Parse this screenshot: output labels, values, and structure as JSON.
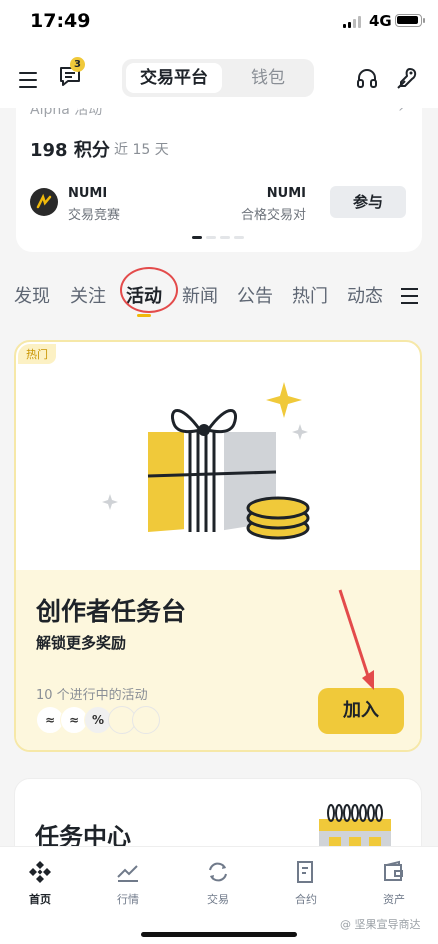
{
  "status_bar": {
    "time": "17:49",
    "network": "4G"
  },
  "top_nav": {
    "message_badge": "3",
    "segments": [
      "交易平台",
      "钱包"
    ]
  },
  "alpha_card": {
    "title": "Alpha 活动",
    "points": "198 积分",
    "points_period": "近 15 天",
    "left_token": "NUMI",
    "left_sub": "交易竞赛",
    "right_token": "NUMI",
    "right_sub": "合格交易对",
    "join_label": "参与"
  },
  "tabs": [
    "发现",
    "关注",
    "活动",
    "新闻",
    "公告",
    "热门",
    "动态"
  ],
  "active_tab": "活动",
  "creator_card": {
    "badge": "热门",
    "title": "创作者任务台",
    "subtitle": "解锁更多奖励",
    "activity_count": "10 个进行中的活动",
    "avatar_glyphs": [
      "≈",
      "≈",
      "%"
    ],
    "join_label": "加入"
  },
  "task_card": {
    "title": "任务中心"
  },
  "bottom_nav": [
    {
      "label": "首页",
      "icon": "binance-logo-icon",
      "active": true
    },
    {
      "label": "行情",
      "icon": "chart-icon",
      "active": false
    },
    {
      "label": "交易",
      "icon": "swap-icon",
      "active": false
    },
    {
      "label": "合约",
      "icon": "contract-icon",
      "active": false
    },
    {
      "label": "资产",
      "icon": "wallet-icon",
      "active": false
    }
  ],
  "watermark": "@ 坚果宣导商达",
  "colors": {
    "accent": "#f0c93a",
    "annotation": "#e34b4b"
  }
}
